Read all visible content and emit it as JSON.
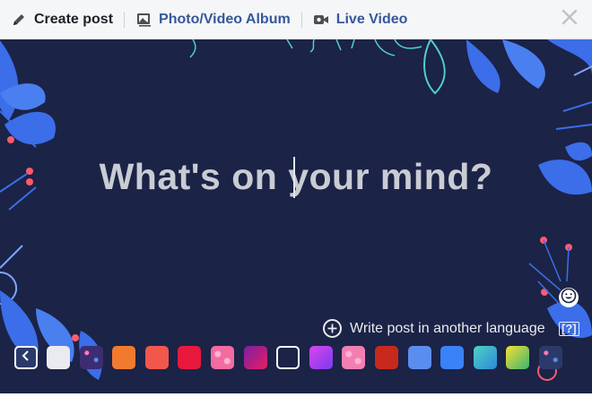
{
  "toolbar": {
    "create_post_label": "Create post",
    "photo_album_label": "Photo/Video Album",
    "live_video_label": "Live Video"
  },
  "composer": {
    "placeholder": "What's on your mind?",
    "write_language_label": "Write post in another language",
    "help_label": "[?]"
  },
  "icons": {
    "create": "pencil-icon",
    "photo": "photo-album-icon",
    "video": "video-camera-icon",
    "close": "close-icon",
    "emoji": "emoji-icon",
    "add": "plus-circle-icon",
    "back": "chevron-left-icon"
  },
  "colors": {
    "background": "#1b2347",
    "accent_link": "#365899",
    "leaf_blue": "#3b6ee8",
    "berry": "#ff5a6e",
    "teal_line": "#4fd1c5"
  },
  "background_swatches": [
    {
      "name": "light-gray",
      "fill": "#e9ebee"
    },
    {
      "name": "purple-pattern",
      "fill": "#3c2d73"
    },
    {
      "name": "orange",
      "fill": "#f27a2e"
    },
    {
      "name": "red-orange",
      "fill": "#f2574c"
    },
    {
      "name": "red",
      "fill": "#e8193c"
    },
    {
      "name": "pink-hearts",
      "fill": "#f26ba1"
    },
    {
      "name": "magenta-gradient",
      "fill": "#c2185b"
    },
    {
      "name": "dark-navy-selected",
      "fill": "#1b2347"
    },
    {
      "name": "purple-gradient",
      "fill": "#b03ee6"
    },
    {
      "name": "pink-pattern",
      "fill": "#f27fb2"
    },
    {
      "name": "red-texture",
      "fill": "#c72a1c"
    },
    {
      "name": "blue",
      "fill": "#5b8def"
    },
    {
      "name": "blue-light",
      "fill": "#3a82f7"
    },
    {
      "name": "teal-green-gradient",
      "fill": "#34c6a8"
    },
    {
      "name": "yellow-green-gradient",
      "fill": "#8fd13a"
    },
    {
      "name": "navy-confetti",
      "fill": "#2b3a6a"
    }
  ]
}
